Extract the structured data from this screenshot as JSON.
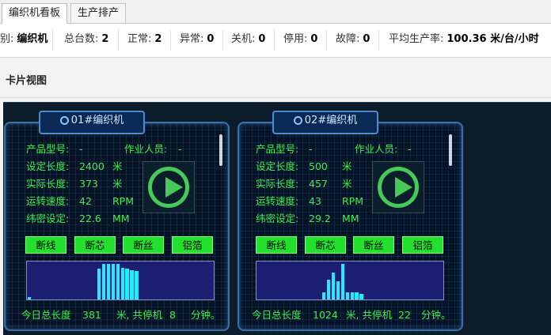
{
  "tabs": [
    {
      "label": "编织机看板",
      "active": true
    },
    {
      "label": "生产排产",
      "active": false
    }
  ],
  "stats": {
    "category_label": "别:",
    "category_value": "编织机",
    "total_label": "总台数:",
    "total_value": "2",
    "normal_label": "正常:",
    "normal_value": "2",
    "abnormal_label": "异常:",
    "abnormal_value": "0",
    "off_label": "关机:",
    "off_value": "0",
    "stopped_label": "停用:",
    "stopped_value": "0",
    "fault_label": "故障:",
    "fault_value": "0",
    "avg_label": "平均生产率:",
    "avg_value": "100.36 米/台/小时"
  },
  "section": {
    "title": "卡片视图"
  },
  "labels": {
    "model": "产品型号:",
    "operator": "作业人员:",
    "set_length": "设定长度:",
    "actual_length": "实际长度:",
    "speed": "运转速度:",
    "weft": "纬密设定:",
    "unit_m": "米",
    "unit_rpm": "RPM",
    "unit_mm": "MM",
    "buttons": [
      "断线",
      "断芯",
      "断丝",
      "铝箔"
    ],
    "footer_prefix": "今日总长度",
    "footer_mid": "米, 共停机",
    "footer_suffix": "分钟。"
  },
  "colors": {
    "accent_green": "#38f24a",
    "bar_cyan": "#25e9ff",
    "chart_bg": "#1d1f72",
    "running": "#47c95a"
  },
  "machines": [
    {
      "title": "01#编织机",
      "model": "-",
      "operator": "-",
      "set_length": "2400",
      "actual_length": "373",
      "speed": "42",
      "weft": "22.6",
      "status_icon": "play-icon",
      "today_length": "381",
      "stop_minutes": "8",
      "histogram": [
        0.06,
        0,
        0,
        0,
        0,
        0,
        0,
        0,
        0,
        0,
        0,
        0,
        0,
        0,
        0,
        0.84,
        0.98,
        0.98,
        0.98,
        0.98,
        0.88,
        0.84,
        0.8,
        0.78,
        0,
        0,
        0,
        0,
        0,
        0,
        0,
        0,
        0,
        0,
        0,
        0,
        0,
        0,
        0,
        0
      ]
    },
    {
      "title": "02#编织机",
      "model": "-",
      "operator": "-",
      "set_length": "500",
      "actual_length": "457",
      "speed": "43",
      "weft": "29.2",
      "status_icon": "play-icon",
      "today_length": "1024",
      "stop_minutes": "22",
      "histogram": [
        0,
        0,
        0,
        0,
        0,
        0,
        0,
        0,
        0,
        0,
        0,
        0,
        0,
        0,
        0.2,
        0.55,
        0.74,
        0.5,
        0.98,
        0.2,
        0.2,
        0.2,
        0.16,
        0,
        0,
        0,
        0,
        0,
        0,
        0,
        0,
        0,
        0,
        0,
        0,
        0,
        0,
        0,
        0,
        0
      ]
    }
  ]
}
